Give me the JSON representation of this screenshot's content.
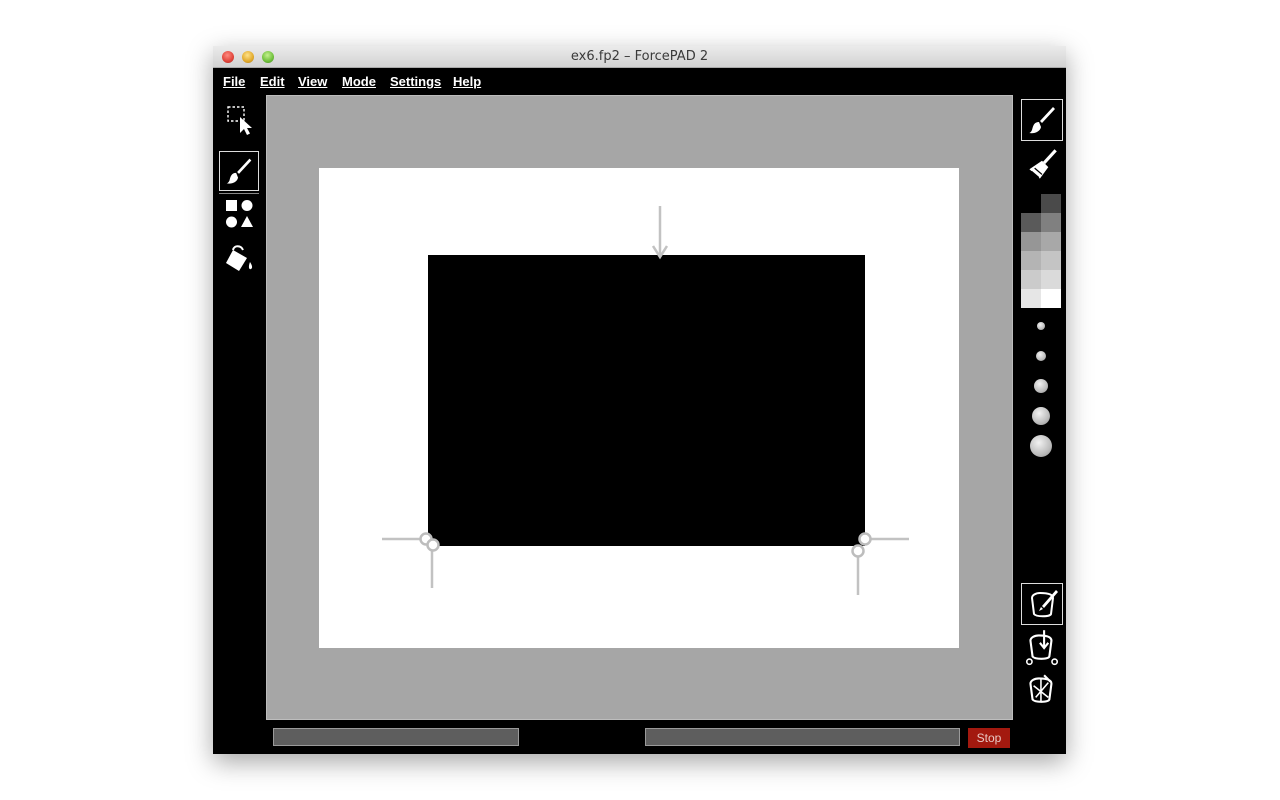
{
  "window": {
    "title": "ex6.fp2 – ForcePAD 2"
  },
  "menu": {
    "items": [
      "File",
      "Edit",
      "View",
      "Mode",
      "Settings",
      "Help"
    ]
  },
  "left_toolbar": {
    "tools": [
      "select-tool",
      "brush-tool",
      "shapes-tool",
      "fill-tool"
    ],
    "active": "brush-tool"
  },
  "right_toolbar": {
    "tools": [
      "brush-tool",
      "eraser-tool"
    ],
    "active_tool": "brush-tool",
    "palette": [
      "#000000",
      "#4a4a4a",
      "#5a5a5a",
      "#808080",
      "#969696",
      "#a8a8a8",
      "#b4b4b4",
      "#c4c4c4",
      "#cbcbcb",
      "#dadada",
      "#e6e6e6",
      "#ffffff"
    ],
    "brush_sizes": 5,
    "modes": [
      "design-mode",
      "constraint-mode",
      "analysis-mode"
    ],
    "active_mode": "design-mode"
  },
  "status": {
    "stop_label": "Stop"
  },
  "colors": {
    "canvas_bg": "#a6a6a6",
    "paper": "#ffffff",
    "shape": "#000000",
    "symbol": "#bdbdbd",
    "stop": "#a3190f"
  }
}
